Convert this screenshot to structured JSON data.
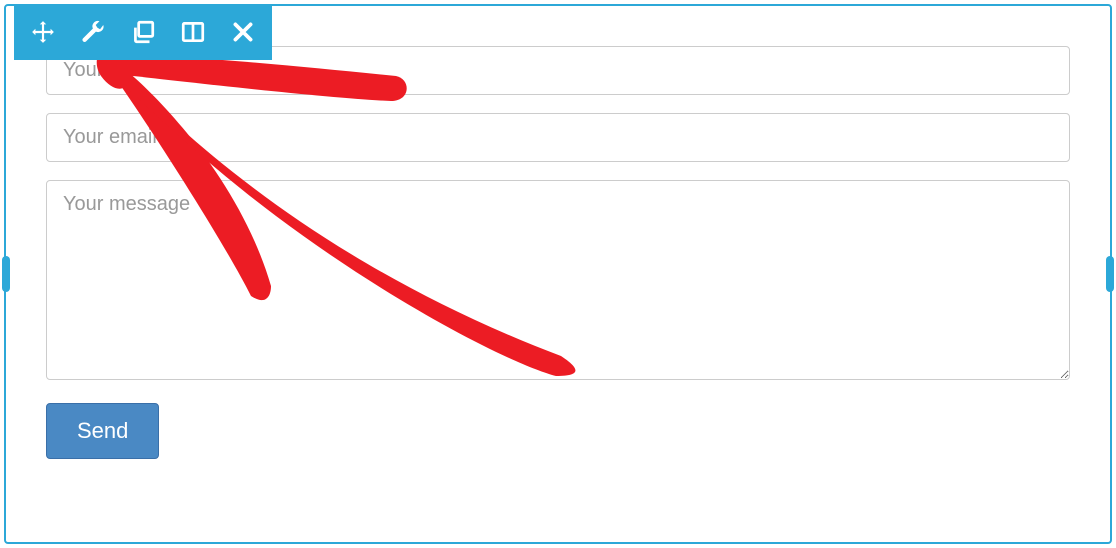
{
  "toolbar": {
    "move_icon": "move-icon",
    "wrench_icon": "wrench-icon",
    "duplicate_icon": "duplicate-icon",
    "columns_icon": "columns-icon",
    "close_icon": "close-icon"
  },
  "form": {
    "name_placeholder": "Your name",
    "email_placeholder": "Your email",
    "message_placeholder": "Your message",
    "submit_label": "Send"
  },
  "colors": {
    "accent": "#2ca8d8",
    "button_bg": "#4a89c4",
    "annotation": "#ec1c24"
  }
}
